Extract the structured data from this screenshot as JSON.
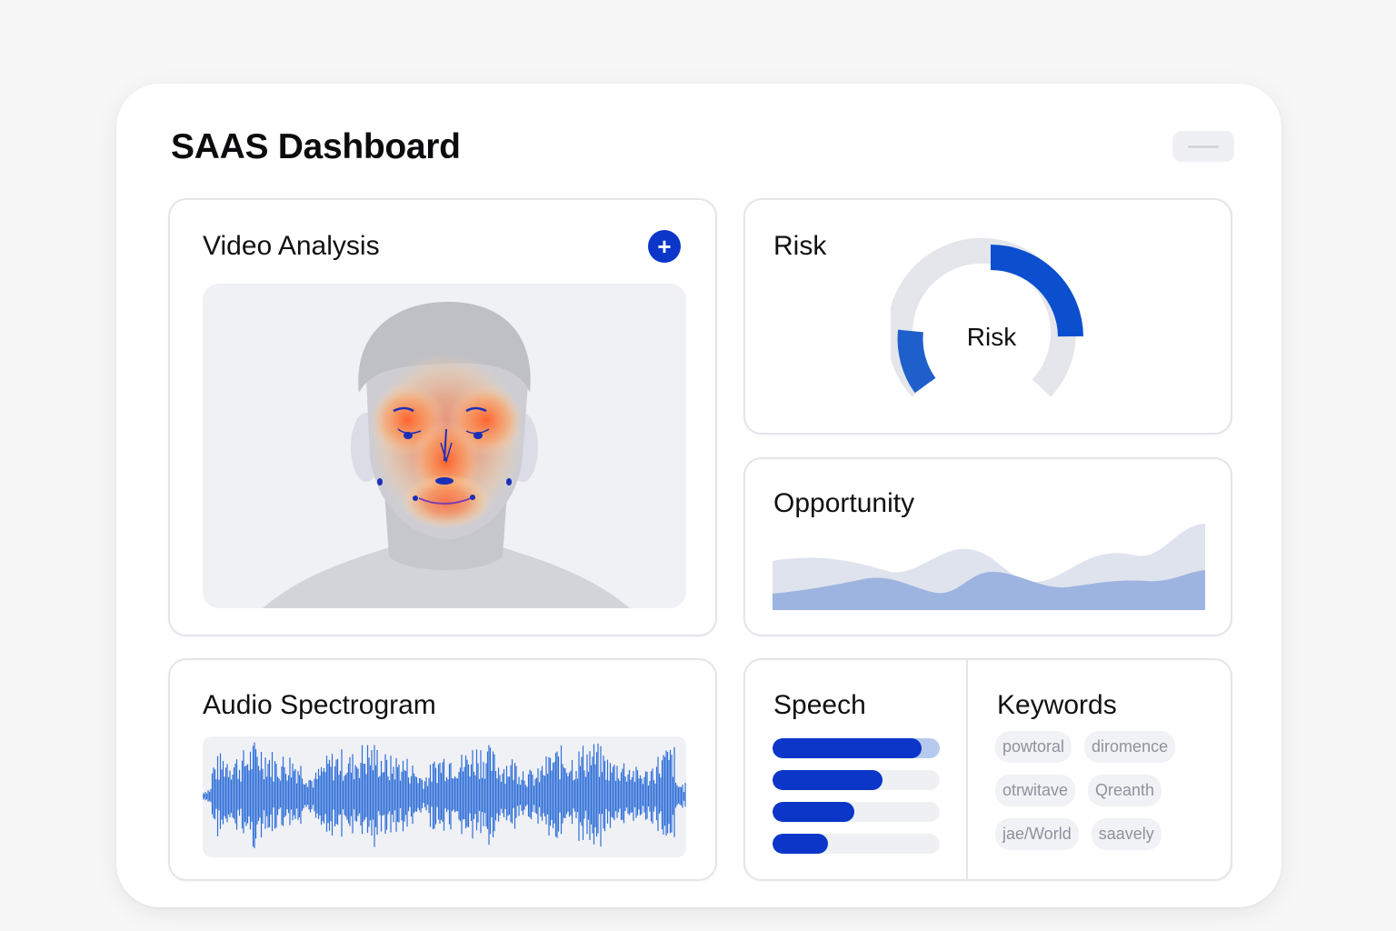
{
  "header": {
    "title": "SAAS Dashboard",
    "menu_icon": "minus-icon"
  },
  "video_analysis": {
    "title": "Video Analysis",
    "add_icon": "plus-icon",
    "add_label": "+"
  },
  "risk": {
    "title": "Risk",
    "gauge_label": "Risk",
    "accent": "#0b4fcf",
    "track": "#e4e6eb"
  },
  "opportunity": {
    "title": "Opportunity",
    "series_colors": [
      "#dfe3ed",
      "#9db4e0"
    ]
  },
  "audio": {
    "title": "Audio Spectrogram",
    "wave_color": "#2f6fd8"
  },
  "speech": {
    "title": "Speech",
    "levels": [
      0.89,
      0.66,
      0.49,
      0.33
    ],
    "bar_color": "#0b36c8"
  },
  "keywords": {
    "title": "Keywords",
    "chips": [
      [
        "powtoral",
        "diromence"
      ],
      [
        "otrwitave",
        "Qreanth"
      ],
      [
        "jae/World",
        "saavely"
      ]
    ]
  }
}
